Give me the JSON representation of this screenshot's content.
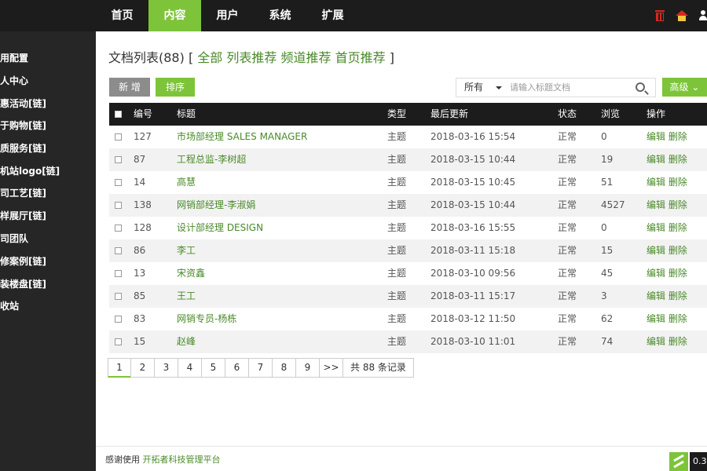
{
  "topnav": {
    "items": [
      "首页",
      "内容",
      "用户",
      "系统",
      "扩展"
    ],
    "active_index": 1
  },
  "top_icons": [
    "trash-icon",
    "home-icon",
    "user-icon"
  ],
  "sidebar": {
    "items": [
      "用配置",
      "人中心",
      "惠活动[链]",
      "于购物[链]",
      "质服务[链]",
      "机站logo[链]",
      "司工艺[链]",
      "样展厅[链]",
      "司团队",
      "修案例[链]",
      "装楼盘[链]",
      "收站"
    ]
  },
  "main": {
    "heading": {
      "title": "文档列表(88)",
      "bracket_open": "[",
      "links": [
        "全部",
        "列表推荐",
        "频道推荐",
        "首页推荐"
      ],
      "bracket_close": "]"
    },
    "toolbar": {
      "add_label": "新 增",
      "sort_label": "排序",
      "select_value": "所有",
      "search_placeholder": "请输入标题文档",
      "advanced_label": "高级"
    },
    "table": {
      "columns": [
        "编号",
        "标题",
        "类型",
        "最后更新",
        "状态",
        "浏览",
        "操作"
      ],
      "rows": [
        {
          "id": "127",
          "title": "市场部经理 SALES MANAGER",
          "type": "主题",
          "updated": "2018-03-16 15:54",
          "status": "正常",
          "views": "0"
        },
        {
          "id": "87",
          "title": "工程总监-李树超",
          "type": "主题",
          "updated": "2018-03-15 10:44",
          "status": "正常",
          "views": "19"
        },
        {
          "id": "14",
          "title": "高慧",
          "type": "主题",
          "updated": "2018-03-15 10:45",
          "status": "正常",
          "views": "51"
        },
        {
          "id": "138",
          "title": "网销部经理-李淑娟",
          "type": "主题",
          "updated": "2018-03-15 10:44",
          "status": "正常",
          "views": "4527"
        },
        {
          "id": "128",
          "title": "设计部经理 DESIGN",
          "type": "主题",
          "updated": "2018-03-16 15:55",
          "status": "正常",
          "views": "0"
        },
        {
          "id": "86",
          "title": "李工",
          "type": "主题",
          "updated": "2018-03-11 15:18",
          "status": "正常",
          "views": "15"
        },
        {
          "id": "13",
          "title": "宋资鑫",
          "type": "主题",
          "updated": "2018-03-10 09:56",
          "status": "正常",
          "views": "45"
        },
        {
          "id": "85",
          "title": "王工",
          "type": "主题",
          "updated": "2018-03-11 15:17",
          "status": "正常",
          "views": "3"
        },
        {
          "id": "83",
          "title": "网销专员-杨栋",
          "type": "主题",
          "updated": "2018-03-12 11:50",
          "status": "正常",
          "views": "62"
        },
        {
          "id": "15",
          "title": "赵峰",
          "type": "主题",
          "updated": "2018-03-10 11:01",
          "status": "正常",
          "views": "74"
        }
      ],
      "edit_label": "编辑",
      "delete_label": "删除"
    },
    "pager": {
      "pages": [
        "1",
        "2",
        "3",
        "4",
        "5",
        "6",
        "7",
        "8",
        "9"
      ],
      "next": ">>",
      "total": "共 88 条记录",
      "current": "1"
    },
    "footer": {
      "prefix": "感谢使用",
      "link": "开拓者科技管理平台"
    },
    "corner_badge": "0.3"
  },
  "colors": {
    "accent": "#7dc43a",
    "topbar": "#1c1c1c",
    "sidebar": "#262626",
    "link": "#4a8a2a",
    "icon_red": "#d9271e"
  }
}
